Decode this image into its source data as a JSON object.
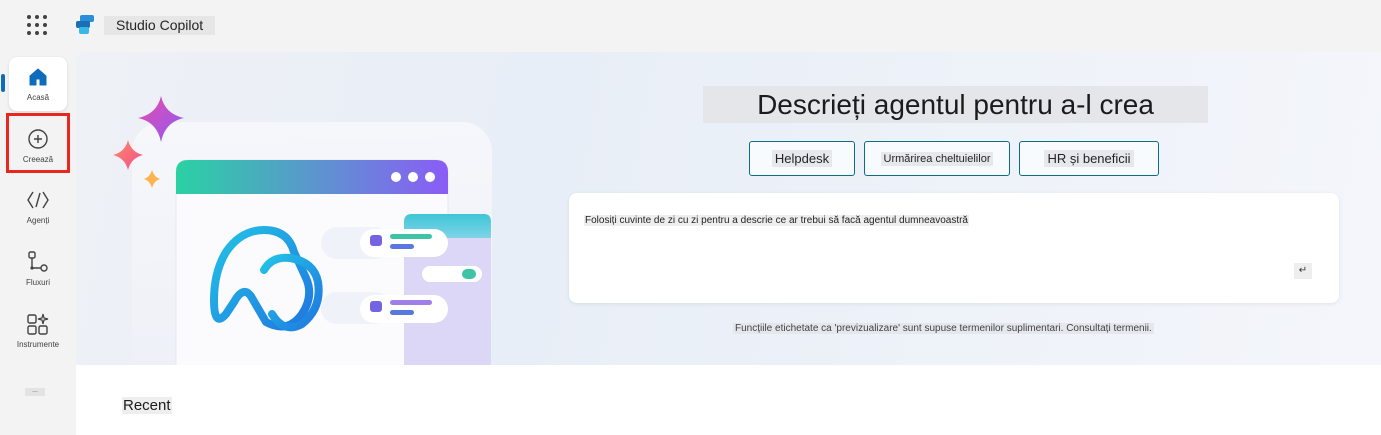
{
  "app": {
    "title": "Studio Copilot"
  },
  "rail": {
    "items": [
      {
        "label": "Acasă",
        "icon": "home-icon"
      },
      {
        "label": "Creează",
        "icon": "add-circle-icon"
      },
      {
        "label": "Agenți",
        "icon": "agents-icon"
      },
      {
        "label": "Fluxuri",
        "icon": "flow-icon"
      },
      {
        "label": "Instrumente",
        "icon": "apps-sparkle-icon"
      },
      {
        "label": "...",
        "icon": "more-icon"
      }
    ]
  },
  "hero": {
    "title": "Descrieți agentul pentru a-l crea",
    "chips": [
      "Helpdesk",
      "Urmărirea cheltuielilor",
      "HR și beneficii"
    ],
    "prompt_placeholder": "Folosiți cuvinte de zi cu zi pentru a descrie ce ar trebui să facă agentul dumneavoastră",
    "send_label": "↵",
    "footnote": "Funcțiile etichetate ca 'previzualizare' sunt supuse termenilor suplimentari. Consultați termenii."
  },
  "recent": {
    "title": "Recent"
  },
  "colors": {
    "accent": "#0f6cbd",
    "highlight": "#e8281f",
    "chip_border": "#0f6c86"
  }
}
